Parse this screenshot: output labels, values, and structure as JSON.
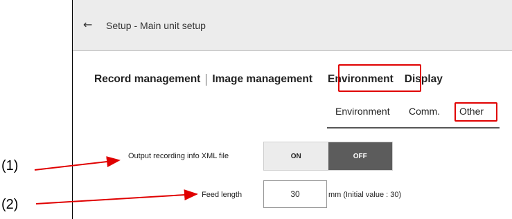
{
  "window": {
    "title": "Setup - Main unit setup",
    "back_icon": "←"
  },
  "main_tabs": [
    {
      "label": "Record management"
    },
    {
      "label": "Image management"
    },
    {
      "label": "Environment",
      "selected": true
    },
    {
      "label": "Display"
    }
  ],
  "sub_tabs": [
    {
      "label": "Environment"
    },
    {
      "label": "Comm."
    },
    {
      "label": "Other",
      "selected": true
    }
  ],
  "settings": {
    "xml_output": {
      "label": "Output recording info XML file",
      "on_label": "ON",
      "off_label": "OFF",
      "value": "OFF"
    },
    "feed_length": {
      "label": "Feed length",
      "value": "30",
      "unit_note": "mm  (Initial value : 30)"
    }
  },
  "annotations": {
    "callout_1": "(1)",
    "callout_2": "(2)",
    "highlight_color": "#e00000"
  },
  "colors": {
    "titlebar": "#ececec",
    "toggle_off_active": "#5c5c5c",
    "highlight": "#e00000"
  }
}
